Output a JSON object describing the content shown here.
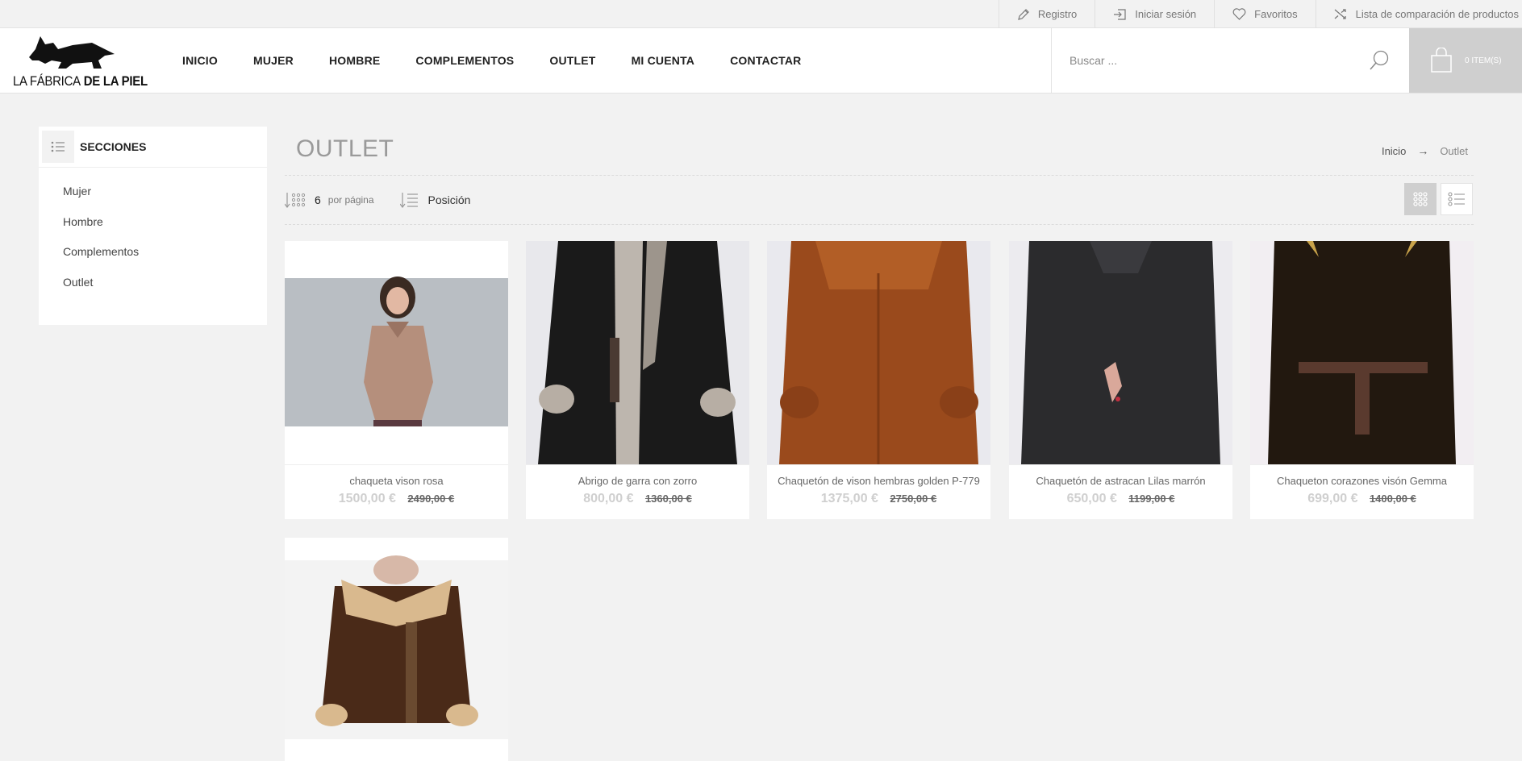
{
  "toplinks": {
    "register": "Registro",
    "login": "Iniciar sesión",
    "favorites": "Favoritos",
    "compare": "Lista de comparación de productos"
  },
  "logo": {
    "part1": "LA FÁBRICA",
    "part2": "DE LA PIEL"
  },
  "nav": [
    "INICIO",
    "MUJER",
    "HOMBRE",
    "COMPLEMENTOS",
    "OUTLET",
    "MI CUENTA",
    "CONTACTAR"
  ],
  "search": {
    "placeholder": "Buscar ..."
  },
  "cart": {
    "label": "0 ITEM(S)"
  },
  "sidebar": {
    "title": "SECCIONES",
    "items": [
      "Mujer",
      "Hombre",
      "Complementos",
      "Outlet"
    ]
  },
  "page": {
    "title": "OUTLET"
  },
  "breadcrumb": {
    "home": "Inicio",
    "arrow": "→",
    "current": "Outlet"
  },
  "toolbar": {
    "limit_value": "6",
    "limit_label": "por página",
    "sort_value": "Posición"
  },
  "products": [
    {
      "name": "chaqueta vison rosa",
      "price": "1500,00 €",
      "old_price": "2490,00 €",
      "coat_color": "#b58f7c"
    },
    {
      "name": "Abrigo de garra con zorro",
      "price": "800,00 €",
      "old_price": "1360,00 €",
      "coat_color": "#1a1a1a"
    },
    {
      "name": "Chaquetón de vison hembras golden P-779",
      "price": "1375,00 €",
      "old_price": "2750,00 €",
      "coat_color": "#9a4a1c"
    },
    {
      "name": "Chaquetón de astracan Lilas marrón",
      "price": "650,00 €",
      "old_price": "1199,00 €",
      "coat_color": "#2b2b2d"
    },
    {
      "name": "Chaqueton corazones visón Gemma",
      "price": "699,00 €",
      "old_price": "1400,00 €",
      "coat_color": "#22180f"
    },
    {
      "name": "",
      "price": "",
      "old_price": "",
      "coat_color": "#4a2a18"
    }
  ],
  "colors": {
    "accent": "#cfcfcf",
    "background": "#f2f2f2"
  }
}
